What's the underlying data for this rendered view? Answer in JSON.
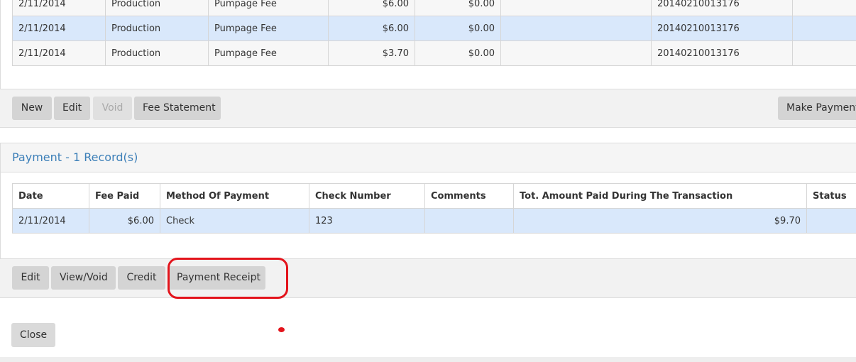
{
  "fee_table": {
    "rows": [
      {
        "date": "2/11/2014",
        "type": "Production",
        "description": "Pumpage Fee",
        "amount": "$6.00",
        "paid": "$0.00",
        "note": "",
        "reference": "20140210013176",
        "extra": ""
      },
      {
        "date": "2/11/2014",
        "type": "Production",
        "description": "Pumpage Fee",
        "amount": "$6.00",
        "paid": "$0.00",
        "note": "",
        "reference": "20140210013176",
        "extra": ""
      },
      {
        "date": "2/11/2014",
        "type": "Production",
        "description": "Pumpage Fee",
        "amount": "$3.70",
        "paid": "$0.00",
        "note": "",
        "reference": "20140210013176",
        "extra": ""
      }
    ]
  },
  "fee_buttons": {
    "new": "New",
    "edit": "Edit",
    "void": "Void",
    "fee_statement": "Fee Statement",
    "make_payment": "Make Payment"
  },
  "payment": {
    "title": "Payment - 1 Record(s)",
    "columns": [
      "Date",
      "Fee Paid",
      "Method Of Payment",
      "Check Number",
      "Comments",
      "Tot. Amount Paid During The Transaction",
      "Status"
    ],
    "rows": [
      {
        "date": "2/11/2014",
        "fee_paid": "$6.00",
        "method": "Check",
        "check_number": "123",
        "comments": "",
        "total": "$9.70",
        "status": ""
      }
    ]
  },
  "payment_buttons": {
    "edit": "Edit",
    "view_void": "View/Void",
    "credit": "Credit",
    "payment_receipt": "Payment Receipt"
  },
  "footer": {
    "close": "Close"
  },
  "colors": {
    "selected_row": "#d9e8fb",
    "title_blue": "#3c7fb8",
    "annotation_red": "#e3141c"
  }
}
